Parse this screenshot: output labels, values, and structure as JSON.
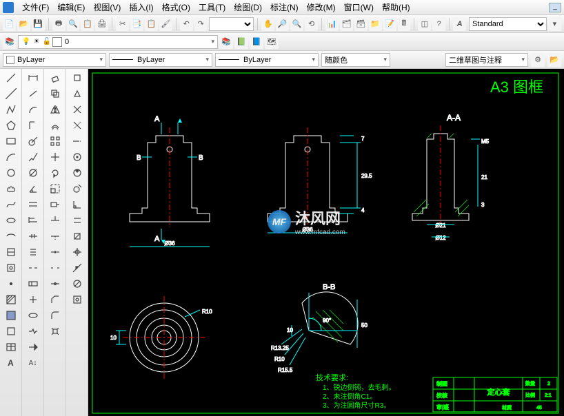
{
  "menu": {
    "items": [
      "文件(F)",
      "编辑(E)",
      "视图(V)",
      "插入(I)",
      "格式(O)",
      "工具(T)",
      "绘图(D)",
      "标注(N)",
      "修改(M)",
      "窗口(W)",
      "帮助(H)"
    ]
  },
  "toolbar1": {
    "style_select": "Standard"
  },
  "layerbar": {
    "layer_select": "0"
  },
  "propbar": {
    "color_sel": "ByLayer",
    "linetype_sel": "ByLayer",
    "lineweight_sel": "ByLayer",
    "plotcolor_sel": "随颜色",
    "workspace_sel": "二维草图与注释"
  },
  "drawing": {
    "frame_title": "A3 图框",
    "section_labels": {
      "aa": "A-A",
      "bb": "B-B",
      "a": "A",
      "b": "B"
    },
    "dims": {
      "d36": "Ø36",
      "d21": "Ø21",
      "d12": "Ø12",
      "v295": "29.5",
      "v7": "7",
      "v4": "4",
      "v21": "21",
      "v3": "3",
      "m5": "M5",
      "v10": "10",
      "v50": "50",
      "r10": "R10",
      "r1325": "R13.25",
      "r155": "R15.5",
      "ang": "90°"
    },
    "tech_req_title": "技术要求:",
    "tech_req_items": [
      "1、锐边倒钝，去毛刺。",
      "2、未注倒角C1。",
      "3、为注圆角尺寸R3。"
    ],
    "titleblock": {
      "part_name": "定心套",
      "row1_l": "制图",
      "row2_l": "校核",
      "row3_l": "审|班",
      "qty_l": "数量",
      "qty_v": "2",
      "scale_l": "比例",
      "scale_v": "2:1",
      "mat_l": "材质",
      "mat_v": "45"
    }
  },
  "watermark": {
    "name": "沐风网",
    "url": "www.mfcad.com",
    "badge": "MF"
  }
}
